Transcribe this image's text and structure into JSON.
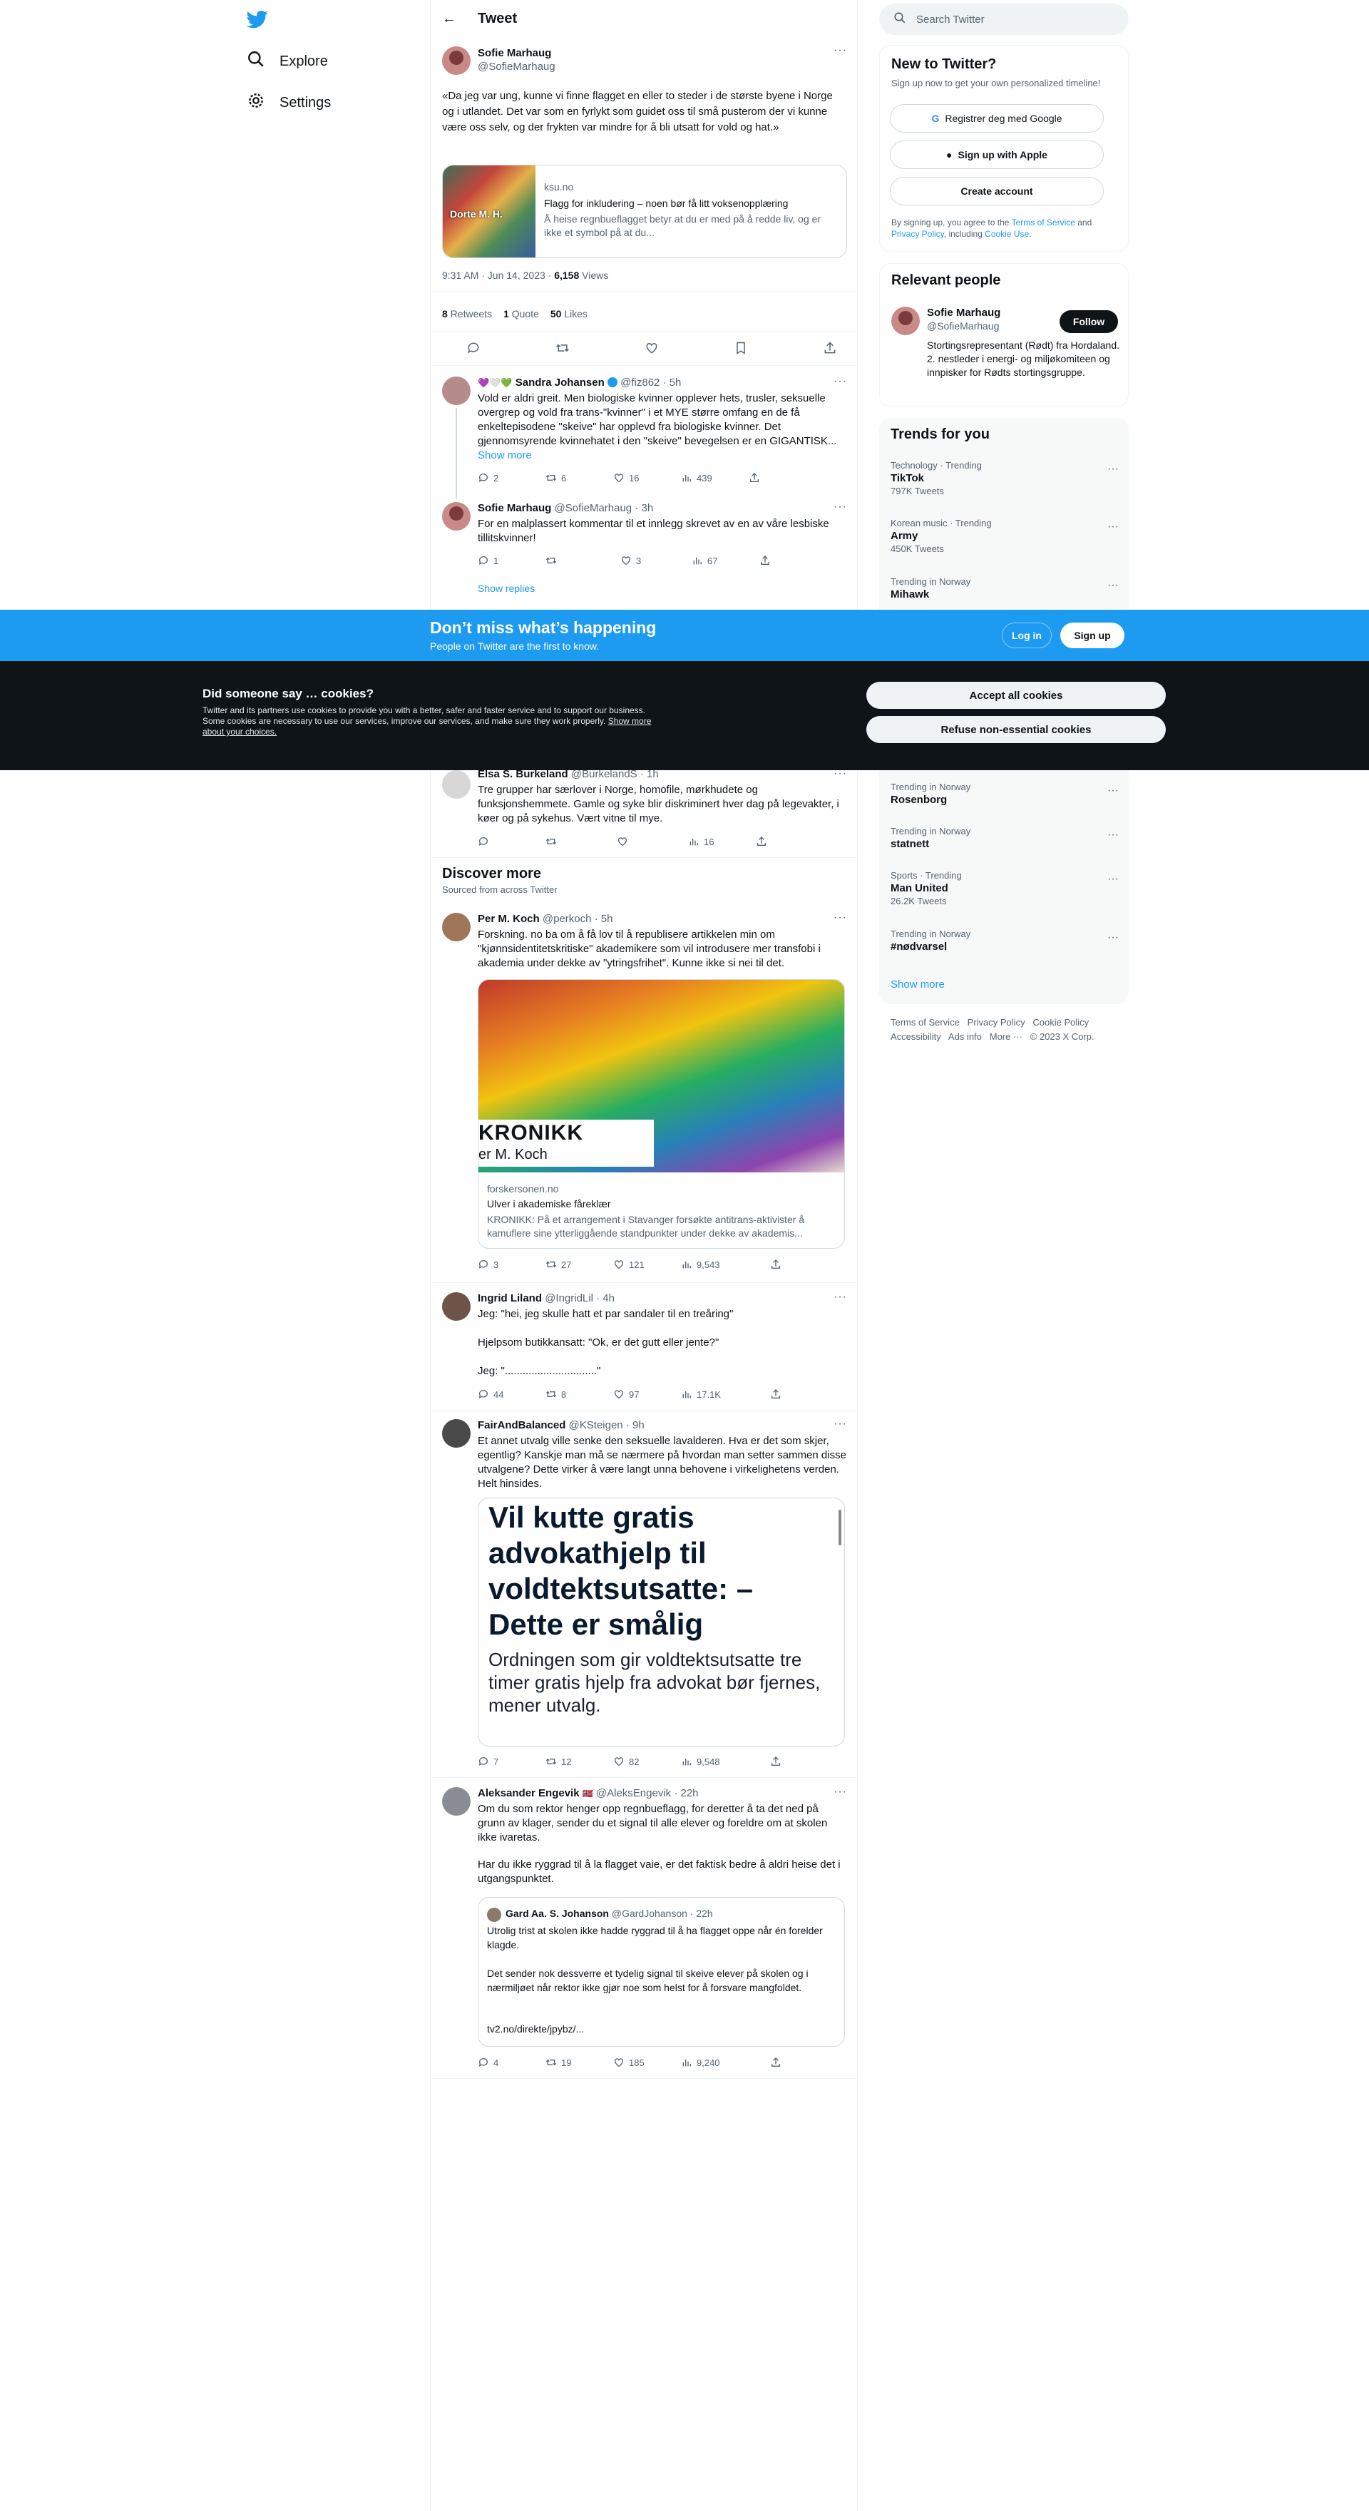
{
  "nav": {
    "explore": "Explore",
    "settings": "Settings"
  },
  "header": {
    "title": "Tweet"
  },
  "tweet": {
    "name": "Sofie Marhaug",
    "handle": "@SofieMarhaug",
    "text": "«Da jeg var ung, kunne vi finne flagget en eller to steder i de største byene i Norge og i utlandet. Det var som en fyrlykt som guidet oss til små pusterom der vi kunne være oss selv, og der frykten var mindre for å bli utsatt for vold og hat.»",
    "card_domain": "ksu.no",
    "card_title": "Flagg for inkludering – noen bør få litt voksenopplæring",
    "card_desc": "Å heise regnbueflagget betyr at du er med på å redde liv, og er ikke et symbol på at du...",
    "card_img_text": "Dorte M. H.",
    "time": "9:31 AM · Jun 14, 2023 · ",
    "views_count": "6,158",
    "views_label": " Views",
    "retweets_count": "8",
    "retweets_label": " Retweets",
    "quote_count": "1",
    "quote_label": " Quote",
    "likes_count": "50",
    "likes_label": " Likes"
  },
  "replies": [
    {
      "name": "Sandra Johansen",
      "emoji": "💜🤍💚",
      "handle": "@fiz862 · 5h",
      "text": "Vold er aldri greit. Men biologiske kvinner opplever hets, trusler, seksuelle overgrep og vold fra trans-\"kvinner\" i et MYE større omfang en de få enkeltepisodene \"skeive\" har opplevd fra biologiske kvinner. Det gjennomsyrende kvinnehatet i den \"skeive\" bevegelsen er en GIGANTISK...",
      "show_more": "Show more",
      "replies": "2",
      "retweets": "6",
      "likes": "16",
      "views": "439"
    },
    {
      "name": "Sofie Marhaug",
      "handle": "@SofieMarhaug · 3h",
      "text": "For en malplassert kommentar til et innlegg skrevet av en av våre lesbiske tillitskvinner!",
      "replies": "1",
      "retweets": "",
      "likes": "3",
      "views": "67",
      "show_replies": "Show replies"
    },
    {
      "name": "Elsa S. Burkeland",
      "handle": "@BurkelandS · 1h",
      "text": "Tre grupper har særlover i Norge, homofile, mørkhudete og funksjonshemmete. Gamle og syke blir diskriminert hver dag på legevakter, i køer og på sykehus. Vært vitne til mye.",
      "replies": "",
      "retweets": "",
      "likes": "",
      "views": "16"
    }
  ],
  "discover": {
    "title": "Discover more",
    "subtitle": "Sourced from across Twitter"
  },
  "posts": [
    {
      "name": "Per M. Koch",
      "handle": "@perkoch · 5h",
      "text": "Forskning. no ba om å få lov til å republisere artikkelen min om \"kjønnsidentitetskritiske\" akademikere som vil introdusere mer transfobi i akademia under dekke av \"ytringsfrihet\". Kunne ikke si nei til det.",
      "img_title": "KRONIKK",
      "img_sub": "er M. Koch",
      "card_domain": "forskersonen.no",
      "card_title": "Ulver i akademiske fåreklær",
      "card_desc": "KRONIKK: På et arrangement i Stavanger forsøkte antitrans-aktivister å kamuflere sine ytterliggående standpunkter under dekke av akademis...",
      "replies": "3",
      "retweets": "27",
      "likes": "121",
      "views": "9,543"
    },
    {
      "name": "Ingrid Liland",
      "handle": "@IngridLil · 4h",
      "text1": "Jeg: \"hei, jeg skulle hatt et par sandaler til en treåring\"",
      "text2": "Hjelpsom butikkansatt: \"Ok, er det gutt eller jente?\"",
      "text3": "Jeg: \"...............................\"",
      "replies": "44",
      "retweets": "8",
      "likes": "97",
      "views": "17.1K"
    },
    {
      "name": "FairAndBalanced",
      "handle": "@KSteigen · 9h",
      "text": "Et annet utvalg ville senke den seksuelle lavalderen. Hva er det som skjer, egentlig? Kanskje man må se nærmere på hvordan man setter sammen disse utvalgene? Dette virker å være langt unna behovene i virkelighetens verden. Helt hinsides.",
      "headline": "Vil kutte gratis advokathjelp til voldtektsutsatte: – Dette er smålig",
      "lead": "Ordningen som gir voldtektsutsatte tre timer gratis hjelp fra advokat bør fjernes, mener utvalg.",
      "replies": "7",
      "retweets": "12",
      "likes": "82",
      "views": "9,548"
    },
    {
      "name": "Aleksander Engevik",
      "emoji": "🇳🇴",
      "handle": "@AleksEngevik · 22h",
      "text1": "Om du som rektor henger opp regnbueflagg, for deretter å ta det ned på grunn av klager, sender du et signal til alle elever og foreldre om at skolen ikke ivaretas.",
      "text2": "Har du ikke ryggrad til å la flagget vaie, er det faktisk bedre å aldri heise det i utgangspunktet.",
      "quote_name": "Gard Aa. S. Johanson",
      "quote_handle": "@GardJohanson · 22h",
      "quote_text1": "Utrolig trist at skolen ikke hadde ryggrad til å ha flagget oppe når én forelder klagde.",
      "quote_text2": "Det sender nok dessverre et tydelig signal til skeive elever på skolen og i nærmiljøet når rektor ikke gjør noe som helst for å forsvare mangfoldet.",
      "quote_link": "tv2.no/direkte/jpybz/...",
      "replies": "4",
      "retweets": "19",
      "likes": "185",
      "views": "9,240"
    }
  ],
  "search": {
    "placeholder": "Search Twitter"
  },
  "signup": {
    "title": "New to Twitter?",
    "subtitle": "Sign up now to get your own personalized timeline!",
    "google": "Registrer deg med Google",
    "apple": "Sign up with Apple",
    "create": "Create account",
    "legal_pre": "By signing up, you agree to the ",
    "tos": "Terms of Service",
    "and": " and ",
    "privacy": "Privacy Policy",
    "including": ", including ",
    "cookie": "Cookie Use",
    "dot": "."
  },
  "relevant": {
    "title": "Relevant people",
    "name": "Sofie Marhaug",
    "handle": "@SofieMarhaug",
    "follow": "Follow",
    "bio": "Stortingsrepresentant (Rødt) fra Hordaland. 2. nestleder i energi- og miljøkomiteen og innpisker for Rødts stortingsgruppe."
  },
  "trends": {
    "title": "Trends for you",
    "items": [
      {
        "cat": "Technology · Trending",
        "title": "TikTok",
        "count": "797K Tweets"
      },
      {
        "cat": "Korean music · Trending",
        "title": "Army",
        "count": "450K Tweets"
      },
      {
        "cat": "Trending in Norway",
        "title": "Mihawk",
        "count": ""
      },
      {
        "cat": "Trending in Norway",
        "title": "Rosenborg",
        "count": ""
      },
      {
        "cat": "Trending in Norway",
        "title": "statnett",
        "count": ""
      },
      {
        "cat": "Sports · Trending",
        "title": "Man United",
        "count": "26.2K Tweets"
      },
      {
        "cat": "Trending in Norway",
        "title": "#nødvarsel",
        "count": ""
      }
    ],
    "show_more": "Show more"
  },
  "footer": {
    "tos": "Terms of Service",
    "privacy": "Privacy Policy",
    "cookie": "Cookie Policy",
    "access": "Accessibility",
    "ads": "Ads info",
    "more": "More ···",
    "copy": "© 2023 X Corp."
  },
  "banner": {
    "title": "Don’t miss what’s happening",
    "subtitle": "People on Twitter are the first to know.",
    "login": "Log in",
    "signup": "Sign up"
  },
  "cookies": {
    "title": "Did someone say … cookies?",
    "text": "Twitter and its partners use cookies to provide you with a better, safer and faster service and to support our business. Some cookies are necessary to use our services, improve our services, and make sure they work properly. ",
    "link": "Show more about your choices.",
    "accept": "Accept all cookies",
    "refuse": "Refuse non-essential cookies"
  },
  "colors": {
    "accent": "#1d9bf0",
    "dark": "#0f1419",
    "muted": "#536471"
  }
}
